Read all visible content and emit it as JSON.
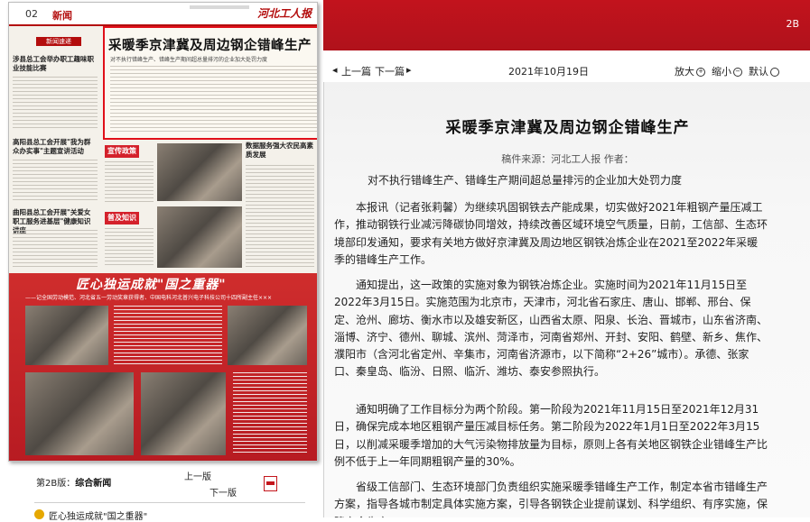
{
  "epaper": {
    "page_number": "02",
    "section_label": "新闻",
    "masthead": "河北工人报",
    "newsflash_label": "新闻速递",
    "left_headline_1": "涉县总工会举办职工趣味职业技能比赛",
    "left_headline_2": "高阳县总工会开展\"我为群众办实事\"主题宣讲活动",
    "left_headline_3": "曲阳县总工会开展\"关爱女职工服务进基层\"健康知识讲座",
    "headline_box_title": "采暖季京津冀及周边钢企错峰生产",
    "headline_box_sub": "对不执行错峰生产、错峰生产期间超总量排污的企业加大处罚力度",
    "publicity_label": "宣传政策",
    "knowledge_label": "普及知识",
    "right_column_title": "数据服务强大农民高素质发展",
    "banner_title": "匠心独运成就\"国之重器\"",
    "banner_sub": "——记全国劳动模范、河北省五一劳动奖章获得者、中国电科河北普兴电子科技公司十四所副主任×××",
    "page_label": "第2B版：",
    "page_name": "综合新闻",
    "prev_page": "上一版",
    "next_page": "下一版",
    "list_item": "匠心独运成就\"国之重器\""
  },
  "topbar": {
    "page_code": "2B"
  },
  "nav": {
    "prev_article": "上一篇",
    "next_article": "下一篇",
    "date": "2021年10月19日",
    "zoom_in": "放大",
    "zoom_out": "缩小",
    "default": "默认"
  },
  "article": {
    "title": "采暖季京津冀及周边钢企错峰生产",
    "source": "稿件来源：河北工人报  作者：",
    "lead": "对不执行错峰生产、错峰生产期间超总量排污的企业加大处罚力度",
    "paragraphs": [
      "本报讯（记者张莉馨）为继续巩固钢铁去产能成果，切实做好2021年粗钢产量压减工作，推动钢铁行业减污降碳协同增效，持续改善区域环境空气质量，日前，工信部、生态环境部印发通知，要求有关地方做好京津冀及周边地区钢铁冶炼企业在2021至2022年采暖季的错峰生产工作。",
      "通知提出，这一政策的实施对象为钢铁冶炼企业。实施时间为2021年11月15日至2022年3月15日。实施范围为北京市，天津市，河北省石家庄、唐山、邯郸、邢台、保定、沧州、廊坊、衡水市以及雄安新区，山西省太原、阳泉、长治、晋城市，山东省济南、淄博、济宁、德州、聊城、滨州、菏泽市，河南省郑州、开封、安阳、鹤壁、新乡、焦作、濮阳市（含河北省定州、辛集市，河南省济源市，以下简称“2+26”城市）。承德、张家口、秦皇岛、临汾、日照、临沂、潍坊、泰安参照执行。",
      "通知明确了工作目标分为两个阶段。第一阶段为2021年11月15日至2021年12月31日，确保完成本地区粗钢产量压减目标任务。第二阶段为2022年1月1日至2022年3月15日，以削减采暖季增加的大气污染物排放量为目标，原则上各有关地区钢铁企业错峰生产比例不低于上一年同期粗钢产量的30%。",
      "省级工信部门、生态环境部门负责组织实施采暖季错峰生产工作，制定本省市错峰生产方案，指导各城市制定具体实施方案，引导各钢铁企业提前谋划、科学组织、有序实施，保障安全生产。"
    ]
  },
  "colors": {
    "brand_red": "#b30d0d",
    "highlight_border": "#e0101a",
    "pdf_red": "#c4161c"
  }
}
